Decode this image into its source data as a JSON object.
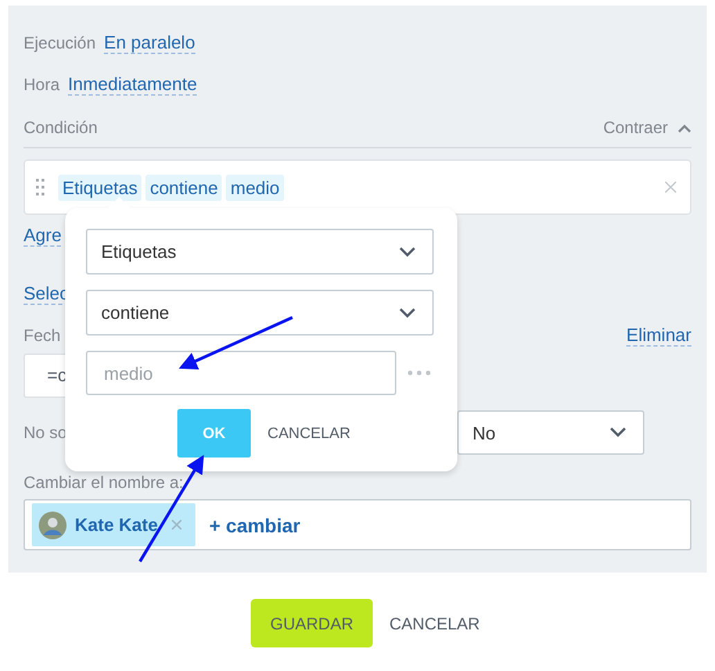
{
  "settings": [
    {
      "label": "Ejecución",
      "value": "En paralelo"
    },
    {
      "label": "Hora",
      "value": "Inmediatamente"
    }
  ],
  "condition": {
    "title": "Condición",
    "collapse_label": "Contraer",
    "tags": [
      "Etiquetas",
      "contiene",
      "medio"
    ]
  },
  "background_links": [
    "Agre",
    "Selec"
  ],
  "date_field": {
    "label": "Fech",
    "delete_link": "Eliminar",
    "value": "=c"
  },
  "option_row": {
    "label": "No so",
    "value": "No"
  },
  "rename": {
    "label": "Cambiar el nombre a:",
    "chips": [
      {
        "name": "Kate Kate"
      }
    ],
    "add_link": "+ cambiar"
  },
  "popup": {
    "field_select": "Etiquetas",
    "operator_select": "contiene",
    "value_placeholder": "medio",
    "ok": "OK",
    "cancel": "CANCELAR"
  },
  "buttons": {
    "save": "GUARDAR",
    "cancel": "CANCELAR"
  }
}
